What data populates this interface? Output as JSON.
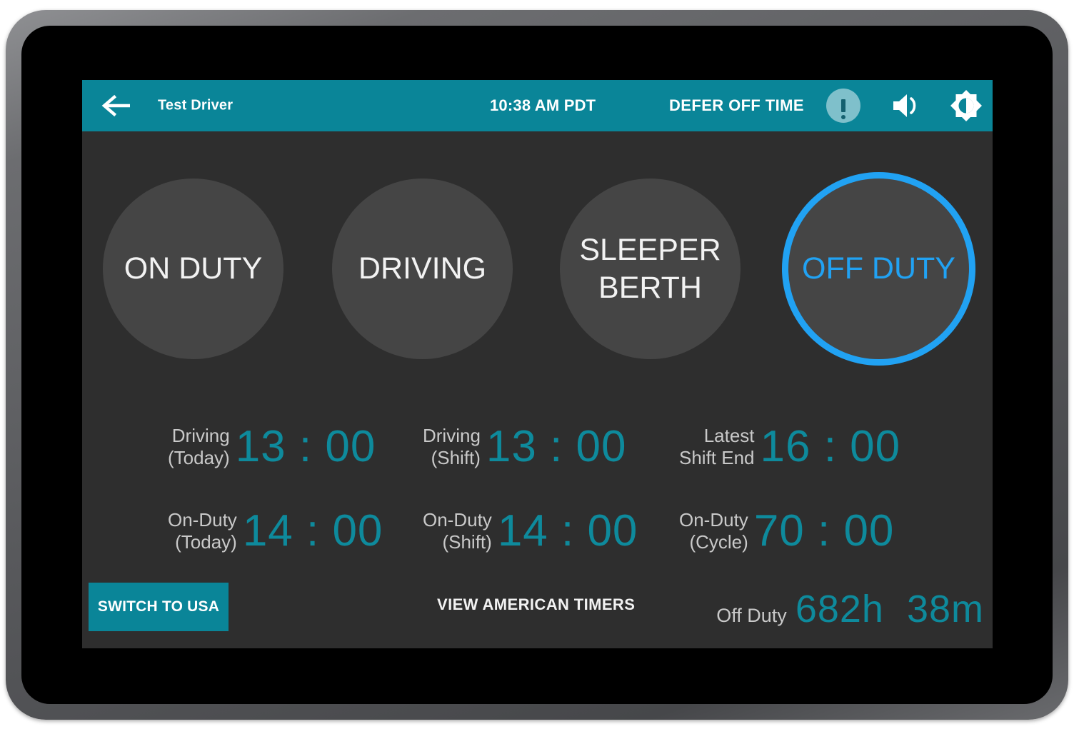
{
  "app": {
    "background_color": "#2e2e2e",
    "accent_teal": "#0a8598",
    "accent_blue": "#21a2f3",
    "value_teal": "#0e8a9c"
  },
  "topbar": {
    "back_icon": "back-arrow-icon",
    "driver_name": "Test Driver",
    "clock": "10:38 AM PDT",
    "defer_label": "DEFER OFF TIME",
    "alert_icon": "alert-exclamation-icon",
    "volume_icon": "volume-icon",
    "brightness_icon": "brightness-icon"
  },
  "duty_statuses": [
    {
      "label": "ON\nDUTY",
      "active": false
    },
    {
      "label": "DRIVING",
      "active": false
    },
    {
      "label": "SLEEPER\nBERTH",
      "active": false
    },
    {
      "label": "OFF\nDUTY",
      "active": true
    }
  ],
  "timers": [
    {
      "label": "Driving\n(Today)",
      "value": "13 : 00"
    },
    {
      "label": "Driving\n(Shift)",
      "value": "13 : 00"
    },
    {
      "label": "Latest\nShift End",
      "value": "16 : 00"
    },
    {
      "label": "On-Duty\n(Today)",
      "value": "14 : 00"
    },
    {
      "label": "On-Duty\n(Shift)",
      "value": "14 : 00"
    },
    {
      "label": "On-Duty\n(Cycle)",
      "value": "70 : 00"
    }
  ],
  "bottombar": {
    "switch_label": "SWITCH TO USA",
    "view_timers_label": "VIEW AMERICAN TIMERS",
    "offduty_label": "Off Duty",
    "offduty_value": "682h  38m"
  }
}
